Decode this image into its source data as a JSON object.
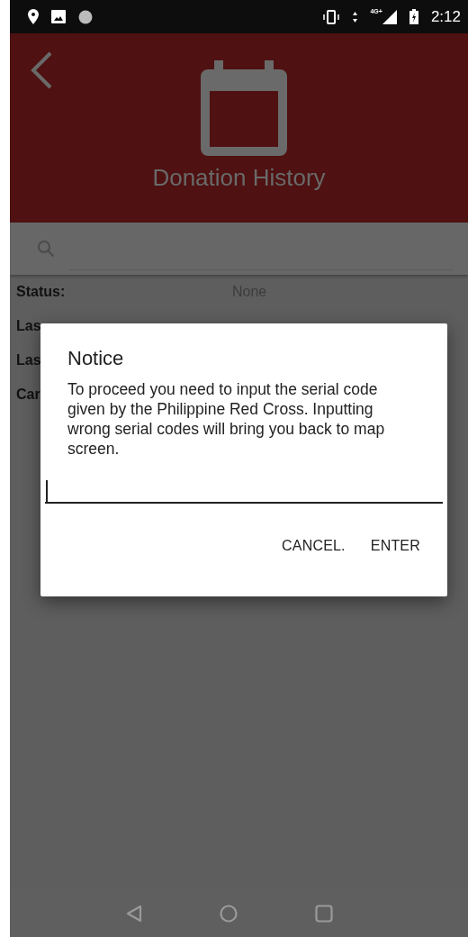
{
  "status_bar": {
    "network": "4G+",
    "time": "2:12"
  },
  "header": {
    "title": "Donation History"
  },
  "search": {
    "focused": false
  },
  "info_rows": [
    {
      "label": "Status:",
      "value": "None"
    },
    {
      "label": "Las"
    },
    {
      "label": "Las"
    },
    {
      "label": "Car"
    }
  ],
  "dialog": {
    "title": "Notice",
    "message": "To proceed you need to input the serial code given by the Philippine Red Cross. Inputting wrong serial codes will bring you back to map screen.",
    "input": {
      "focused": true
    },
    "buttons": [
      {
        "label": "CANCEL."
      },
      {
        "label": "ENTER"
      }
    ]
  }
}
